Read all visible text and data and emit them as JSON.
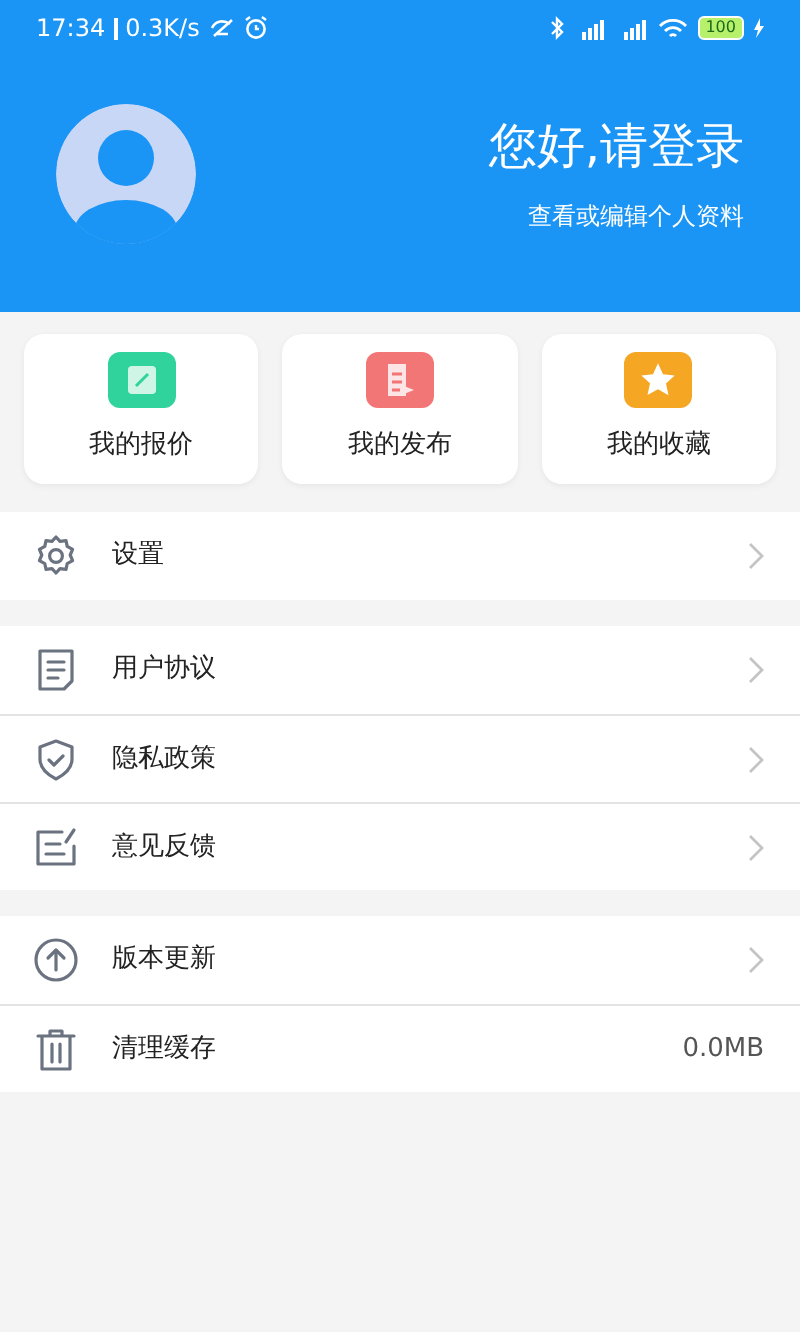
{
  "status_bar": {
    "time": "17:34",
    "speed": "0.3K/s",
    "battery": "100"
  },
  "profile": {
    "greeting": "您好,请登录",
    "subtitle": "查看或编辑个人资料"
  },
  "shortcuts": [
    {
      "label": "我的报价"
    },
    {
      "label": "我的发布"
    },
    {
      "label": "我的收藏"
    }
  ],
  "groups": [
    {
      "rows": [
        {
          "label": "设置",
          "kind": "link"
        }
      ]
    },
    {
      "rows": [
        {
          "label": "用户协议",
          "kind": "link"
        },
        {
          "label": "隐私政策",
          "kind": "link"
        },
        {
          "label": "意见反馈",
          "kind": "link"
        }
      ]
    },
    {
      "rows": [
        {
          "label": "版本更新",
          "kind": "link"
        },
        {
          "label": "清理缓存",
          "kind": "value",
          "value": "0.0MB"
        }
      ]
    }
  ]
}
